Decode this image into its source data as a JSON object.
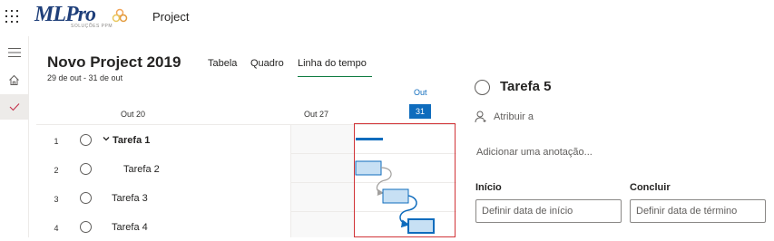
{
  "app": {
    "title": "Project",
    "logo_text": "MLPro",
    "logo_subtext": "SOLUÇÕES PPM"
  },
  "project": {
    "name": "Novo Project 2019",
    "dates": "29 de out - 31 de out"
  },
  "tabs": [
    {
      "label": "Tabela",
      "active": false
    },
    {
      "label": "Quadro",
      "active": false
    },
    {
      "label": "Linha do tempo",
      "active": true
    }
  ],
  "timeline": {
    "date_labels": [
      "Out 20",
      "Out 27"
    ],
    "month": "Out",
    "today": "31"
  },
  "tasks": [
    {
      "num": "1",
      "name": "Tarefa 1",
      "summary": true
    },
    {
      "num": "2",
      "name": "Tarefa 2",
      "summary": false
    },
    {
      "num": "3",
      "name": "Tarefa 3",
      "summary": false
    },
    {
      "num": "4",
      "name": "Tarefa 4",
      "summary": false
    }
  ],
  "detail": {
    "title": "Tarefa 5",
    "assign_label": "Atribuir a",
    "note_placeholder": "Adicionar uma anotação...",
    "start_label": "Início",
    "start_placeholder": "Definir data de início",
    "end_label": "Concluir",
    "end_placeholder": "Definir data de término"
  },
  "colors": {
    "accent": "#0f6cbd",
    "tab_underline": "#107c41",
    "bar_fill": "#c7e0f4",
    "highlight_frame": "#d13438",
    "brand": "#1f3f7a"
  },
  "icons": [
    "app-launcher-icon",
    "hamburger-menu-icon",
    "home-icon",
    "checkmark-icon",
    "chevron-down-icon",
    "person-icon"
  ]
}
